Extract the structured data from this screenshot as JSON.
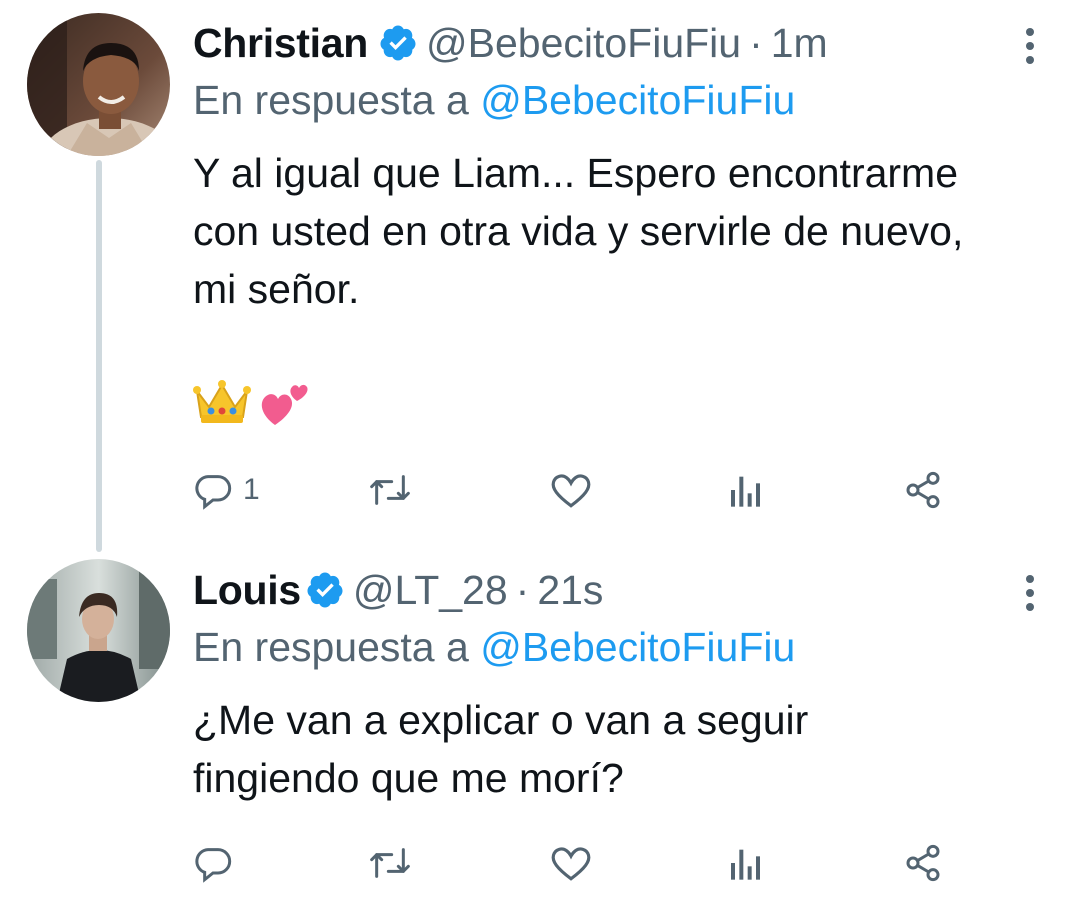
{
  "tweets": [
    {
      "name": "Christian",
      "handle": "@BebecitoFiuFiu",
      "separator": "·",
      "time": "1m",
      "reply_prefix": "En respuesta a",
      "reply_to": "@BebecitoFiuFiu",
      "text": "Y al igual que Liam... Espero encontrarme con usted en otra vida y servirle de nuevo, mi señor.",
      "emojis": [
        "crown-emoji",
        "two-hearts-emoji"
      ],
      "reply_count": "1"
    },
    {
      "name": "Louis",
      "handle": "@LT_28",
      "separator": "·",
      "time": "21s",
      "reply_prefix": "En respuesta a",
      "reply_to": "@BebecitoFiuFiu",
      "text": "¿Me van a explicar o van a seguir fingiendo que me morí?",
      "reply_count": ""
    }
  ],
  "icons": [
    "verified-badge-icon",
    "more-options-icon",
    "reply-icon",
    "retweet-icon",
    "like-icon",
    "stats-icon",
    "share-icon"
  ],
  "colors": {
    "accent": "#1d9bf0",
    "secondary_text": "#536471",
    "primary_text": "#0f1419",
    "thread_line": "#cfd9de"
  }
}
